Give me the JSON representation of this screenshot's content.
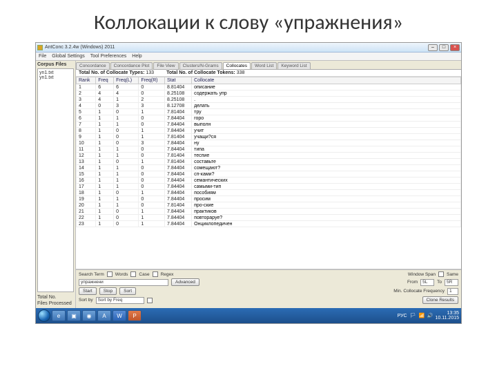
{
  "slide": {
    "title": "Коллокации к слову «упражнения»"
  },
  "window": {
    "title": "AntConc 3.2.4w (Windows) 2011",
    "menus": [
      "File",
      "Global Settings",
      "Tool Preferences",
      "Help"
    ]
  },
  "sidebar": {
    "header": "Corpus Files",
    "files": [
      "yn1.txt",
      "yn1.txt"
    ],
    "totals_label": "Total No.",
    "files_processed_label": "Files Processed"
  },
  "tabs": {
    "items": [
      "Concordance",
      "Concordance Plot",
      "File View",
      "Clusters/N-Grams",
      "Collocates",
      "Word List",
      "Keyword List"
    ],
    "active_index": 4
  },
  "summary": {
    "types_label": "Total No. of Collocate Types:",
    "types_value": "133",
    "tokens_label": "Total No. of Collocate Tokens:",
    "tokens_value": "338"
  },
  "columns": [
    "Rank",
    "Freq",
    "Freq(L)",
    "Freq(R)",
    "Stat",
    "Collocate"
  ],
  "rows": [
    {
      "rank": "1",
      "freq": "6",
      "l": "6",
      "r": "0",
      "stat": "8.81404",
      "word": "описание"
    },
    {
      "rank": "2",
      "freq": "4",
      "l": "4",
      "r": "0",
      "stat": "8.25108",
      "word": "содержать упр"
    },
    {
      "rank": "3",
      "freq": "4",
      "l": "1",
      "r": "2",
      "stat": "8.25108",
      "word": "."
    },
    {
      "rank": "4",
      "freq": "0",
      "l": "3",
      "r": "3",
      "stat": "8.12708",
      "word": "делать"
    },
    {
      "rank": "5",
      "freq": "1",
      "l": "0",
      "r": "1",
      "stat": "7.81404",
      "word": "тру"
    },
    {
      "rank": "6",
      "freq": "1",
      "l": "1",
      "r": "0",
      "stat": "7.84404",
      "word": "горо"
    },
    {
      "rank": "7",
      "freq": "1",
      "l": "1",
      "r": "0",
      "stat": "7.84404",
      "word": "выполн"
    },
    {
      "rank": "8",
      "freq": "1",
      "l": "0",
      "r": "1",
      "stat": "7.84404",
      "word": "учит"
    },
    {
      "rank": "9",
      "freq": "1",
      "l": "0",
      "r": "1",
      "stat": "7.81404",
      "word": "учащи?ся"
    },
    {
      "rank": "10",
      "freq": "1",
      "l": "0",
      "r": "3",
      "stat": "7.84404",
      "word": "ну"
    },
    {
      "rank": "11",
      "freq": "1",
      "l": "1",
      "r": "0",
      "stat": "7.84404",
      "word": "типа"
    },
    {
      "rank": "12",
      "freq": "1",
      "l": "1",
      "r": "0",
      "stat": "7.81404",
      "word": "теспие"
    },
    {
      "rank": "13",
      "freq": "1",
      "l": "0",
      "r": "1",
      "stat": "7.81404",
      "word": "составьте"
    },
    {
      "rank": "14",
      "freq": "1",
      "l": "1",
      "r": "0",
      "stat": "7.84404",
      "word": "сомещают?"
    },
    {
      "rank": "15",
      "freq": "1",
      "l": "1",
      "r": "0",
      "stat": "7.84404",
      "word": "сп-ками?"
    },
    {
      "rank": "16",
      "freq": "1",
      "l": "1",
      "r": "0",
      "stat": "7.84404",
      "word": "семантических"
    },
    {
      "rank": "17",
      "freq": "1",
      "l": "1",
      "r": "0",
      "stat": "7.84404",
      "word": "самыми-тип"
    },
    {
      "rank": "18",
      "freq": "1",
      "l": "0",
      "r": "1",
      "stat": "7.84404",
      "word": "пособиям"
    },
    {
      "rank": "19",
      "freq": "1",
      "l": "1",
      "r": "0",
      "stat": "7.84404",
      "word": "просим"
    },
    {
      "rank": "20",
      "freq": "1",
      "l": "1",
      "r": "0",
      "stat": "7.81404",
      "word": "про-ские"
    },
    {
      "rank": "21",
      "freq": "1",
      "l": "0",
      "r": "1",
      "stat": "7.84404",
      "word": "практиков"
    },
    {
      "rank": "22",
      "freq": "1",
      "l": "0",
      "r": "1",
      "stat": "7.84404",
      "word": "повтораруе?"
    },
    {
      "rank": "23",
      "freq": "1",
      "l": "0",
      "r": "1",
      "stat": "7.84404",
      "word": "Онциклопедичен"
    }
  ],
  "controls": {
    "search_label": "Search Term",
    "words_check": "Words",
    "case_check": "Case",
    "regex_check": "Regex",
    "search_value": "упражнени",
    "start_btn": "Start",
    "stop_btn": "Stop",
    "sort_btn": "Sort",
    "sort_by_label": "Sort by",
    "sort_by_value": "Sort by Freq",
    "advanced_btn": "Advanced",
    "window_span_label": "Window Span",
    "from_label": "From",
    "from_value": "5L",
    "to_label": "To",
    "to_value": "5R",
    "min_freq_label": "Min. Collocate Frequency",
    "min_freq_value": "1",
    "clone_btn": "Clone Results"
  },
  "taskbar": {
    "time": "13:35",
    "date": "10.11.2015",
    "lang": "РУС"
  }
}
